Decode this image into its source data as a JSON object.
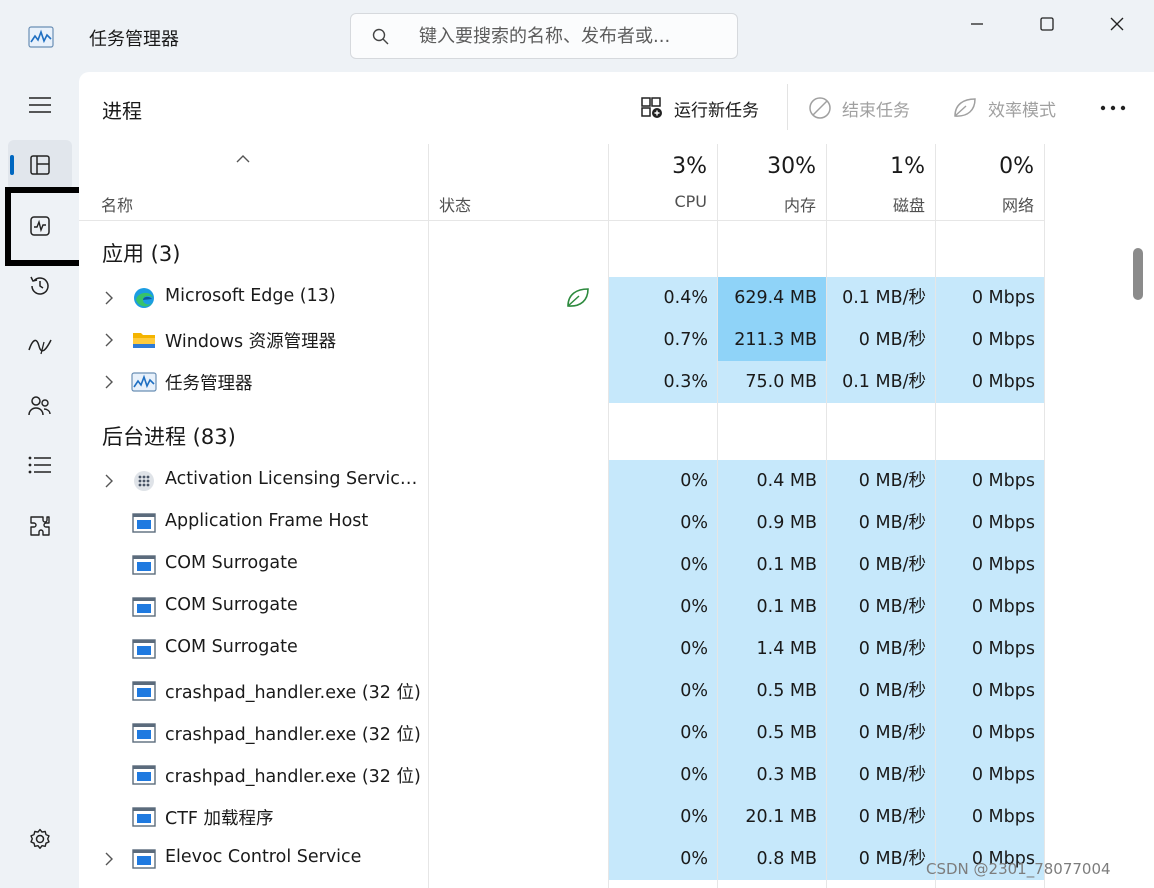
{
  "window": {
    "title": "任务管理器"
  },
  "search": {
    "placeholder": "键入要搜索的名称、发布者或..."
  },
  "page": {
    "title": "进程"
  },
  "commands": {
    "run_new_task": "运行新任务",
    "end_task": "结束任务",
    "efficiency_mode": "效率模式"
  },
  "columns": {
    "name": "名称",
    "status": "状态",
    "cpu": {
      "pct": "3%",
      "label": "CPU"
    },
    "memory": {
      "pct": "30%",
      "label": "内存"
    },
    "disk": {
      "pct": "1%",
      "label": "磁盘"
    },
    "network": {
      "pct": "0%",
      "label": "网络"
    }
  },
  "groups": {
    "apps": "应用 (3)",
    "background": "后台进程 (83)"
  },
  "apps": [
    {
      "name": "Microsoft Edge (13)",
      "cpu": "0.4%",
      "mem": "629.4 MB",
      "disk": "0.1 MB/秒",
      "net": "0 Mbps",
      "expandable": true,
      "icon": "edge-icon",
      "efficiency": true
    },
    {
      "name": "Windows 资源管理器",
      "cpu": "0.7%",
      "mem": "211.3 MB",
      "disk": "0 MB/秒",
      "net": "0 Mbps",
      "expandable": true,
      "icon": "folder-icon"
    },
    {
      "name": "任务管理器",
      "cpu": "0.3%",
      "mem": "75.0 MB",
      "disk": "0.1 MB/秒",
      "net": "0 Mbps",
      "expandable": true,
      "icon": "task-manager-icon"
    }
  ],
  "background": [
    {
      "name": "Activation Licensing Service...",
      "cpu": "0%",
      "mem": "0.4 MB",
      "disk": "0 MB/秒",
      "net": "0 Mbps",
      "expandable": true,
      "icon": "service-icon"
    },
    {
      "name": "Application Frame Host",
      "cpu": "0%",
      "mem": "0.9 MB",
      "disk": "0 MB/秒",
      "net": "0 Mbps",
      "expandable": false,
      "icon": "window-icon"
    },
    {
      "name": "COM Surrogate",
      "cpu": "0%",
      "mem": "0.1 MB",
      "disk": "0 MB/秒",
      "net": "0 Mbps",
      "expandable": false,
      "icon": "window-icon"
    },
    {
      "name": "COM Surrogate",
      "cpu": "0%",
      "mem": "0.1 MB",
      "disk": "0 MB/秒",
      "net": "0 Mbps",
      "expandable": false,
      "icon": "window-icon"
    },
    {
      "name": "COM Surrogate",
      "cpu": "0%",
      "mem": "1.4 MB",
      "disk": "0 MB/秒",
      "net": "0 Mbps",
      "expandable": false,
      "icon": "window-icon"
    },
    {
      "name": "crashpad_handler.exe (32 位)",
      "cpu": "0%",
      "mem": "0.5 MB",
      "disk": "0 MB/秒",
      "net": "0 Mbps",
      "expandable": false,
      "icon": "window-icon"
    },
    {
      "name": "crashpad_handler.exe (32 位)",
      "cpu": "0%",
      "mem": "0.5 MB",
      "disk": "0 MB/秒",
      "net": "0 Mbps",
      "expandable": false,
      "icon": "window-icon"
    },
    {
      "name": "crashpad_handler.exe (32 位)",
      "cpu": "0%",
      "mem": "0.3 MB",
      "disk": "0 MB/秒",
      "net": "0 Mbps",
      "expandable": false,
      "icon": "window-icon"
    },
    {
      "name": "CTF 加载程序",
      "cpu": "0%",
      "mem": "20.1 MB",
      "disk": "0 MB/秒",
      "net": "0 Mbps",
      "expandable": false,
      "icon": "window-icon"
    },
    {
      "name": "Elevoc Control Service",
      "cpu": "0%",
      "mem": "0.8 MB",
      "disk": "0 MB/秒",
      "net": "0 Mbps",
      "expandable": true,
      "icon": "window-icon"
    }
  ],
  "watermark": "CSDN @2301_78077004",
  "colors": {
    "accent": "#0067c0",
    "heat_low": "#c6e8fb",
    "heat_high": "#8fd3f8"
  }
}
